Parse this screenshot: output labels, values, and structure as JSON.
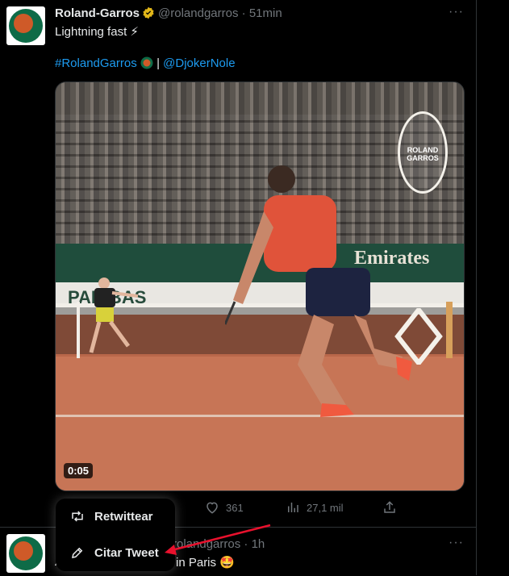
{
  "tweet1": {
    "author_name": "Roland-Garros",
    "handle": "@rolandgarros",
    "time": "51min",
    "text": "Lightning fast ⚡",
    "hashtag": "#RolandGarros",
    "separator": "|",
    "mention": "@DjokerNole",
    "video_duration": "0:05",
    "likes": "361",
    "views": "27,1 mil",
    "media_board_text": "Emirates",
    "media_board2_text": "PARIBAS",
    "media_logo_text": "ROLAND GARROS"
  },
  "menu": {
    "retweet_label": "Retwittear",
    "quote_label": "Citar Tweet"
  },
  "tweet2": {
    "author_name": "R",
    "handle": "rolandgarros",
    "time": "1h",
    "text_prefix": "A",
    "text_suffix": "in Paris 🤩"
  },
  "colors": {
    "background": "#000000",
    "link": "#1d9bf0",
    "muted": "#71767b",
    "arrow": "#e8112d"
  },
  "icons": [
    "verified-badge-icon",
    "more-icon",
    "reply-icon",
    "retweet-icon",
    "like-icon",
    "views-icon",
    "share-icon",
    "edit-icon"
  ]
}
